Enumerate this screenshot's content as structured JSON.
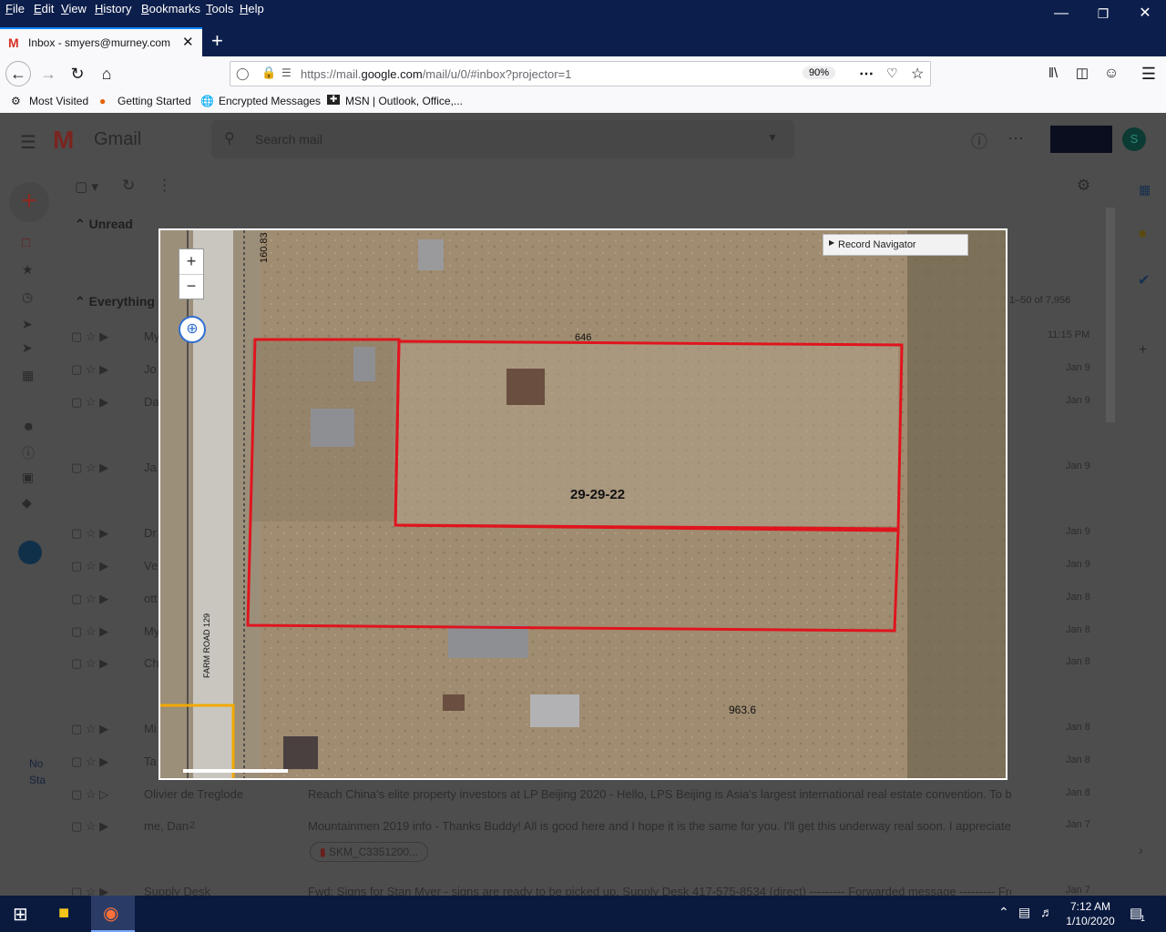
{
  "menubar": {
    "items": [
      "File",
      "Edit",
      "View",
      "History",
      "Bookmarks",
      "Tools",
      "Help"
    ]
  },
  "tab": {
    "title": "Inbox - smyers@murney.com"
  },
  "url": {
    "text_prefix": "https://mail.",
    "text_domain": "google.com",
    "text_suffix": "/mail/u/0/#inbox?projector=1",
    "zoom": "90%"
  },
  "bookmarks": [
    "Most Visited",
    "Getting Started",
    "Encrypted Messages",
    "MSN | Outlook, Office,..."
  ],
  "gmail": {
    "app_name": "Gmail",
    "search_placeholder": "Search mail",
    "section_unread": "Unread",
    "section_everything": "Everything",
    "count": "1–50 of 7,956",
    "rows": [
      {
        "sender": "My",
        "date": "11:15 PM"
      },
      {
        "sender": "Jo",
        "date": "Jan 9"
      },
      {
        "sender": "Da",
        "date": "Jan 9"
      },
      {
        "sender": "Ja",
        "date": "Jan 9"
      },
      {
        "sender": "Dr",
        "date": "Jan 9"
      },
      {
        "sender": "Ve",
        "date": "Jan 9"
      },
      {
        "sender": "ott",
        "date": "Jan 8"
      },
      {
        "sender": "My",
        "date": "Jan 8"
      },
      {
        "sender": "Ch",
        "date": "Jan 8"
      },
      {
        "sender": "Mi",
        "date": "Jan 8"
      },
      {
        "sender": "Ta",
        "date": "Jan 8"
      },
      {
        "sender": "Olivier de Treglode",
        "subject": "Reach China's elite property investors at LP Beijing 2020",
        "snippet": " - Hello, LPS Beijing is Asia's largest international real estate convention. To b...",
        "date": "Jan 8"
      },
      {
        "sender": "me, Dan",
        "count": "2",
        "subject": "Mountainmen 2019 info",
        "snippet": " - Thanks Buddy! All is good here and I hope it is the same for you. I'll get this underway real soon. I appreciate...",
        "date": "Jan 7",
        "attachment": "SKM_C3351200..."
      },
      {
        "sender": "Supply Desk",
        "subject": "Fwd: Signs for Stan Myer",
        "snippet": " - signs are ready to be picked up. Supply Desk 417-575-8534 (direct) --------- Forwarded message --------- From:",
        "date": "Jan 7"
      }
    ],
    "sidebar_no_chats": "No Sta"
  },
  "map": {
    "record_navigator": "Record Navigator",
    "parcel_label": "29-29-22",
    "labels": [
      "160.83",
      "646",
      "963.6",
      "FARM ROAD 129"
    ],
    "zoom_in": "+",
    "zoom_out": "−"
  },
  "taskbar": {
    "time": "7:12 AM",
    "date": "1/10/2020",
    "notif": "1"
  }
}
